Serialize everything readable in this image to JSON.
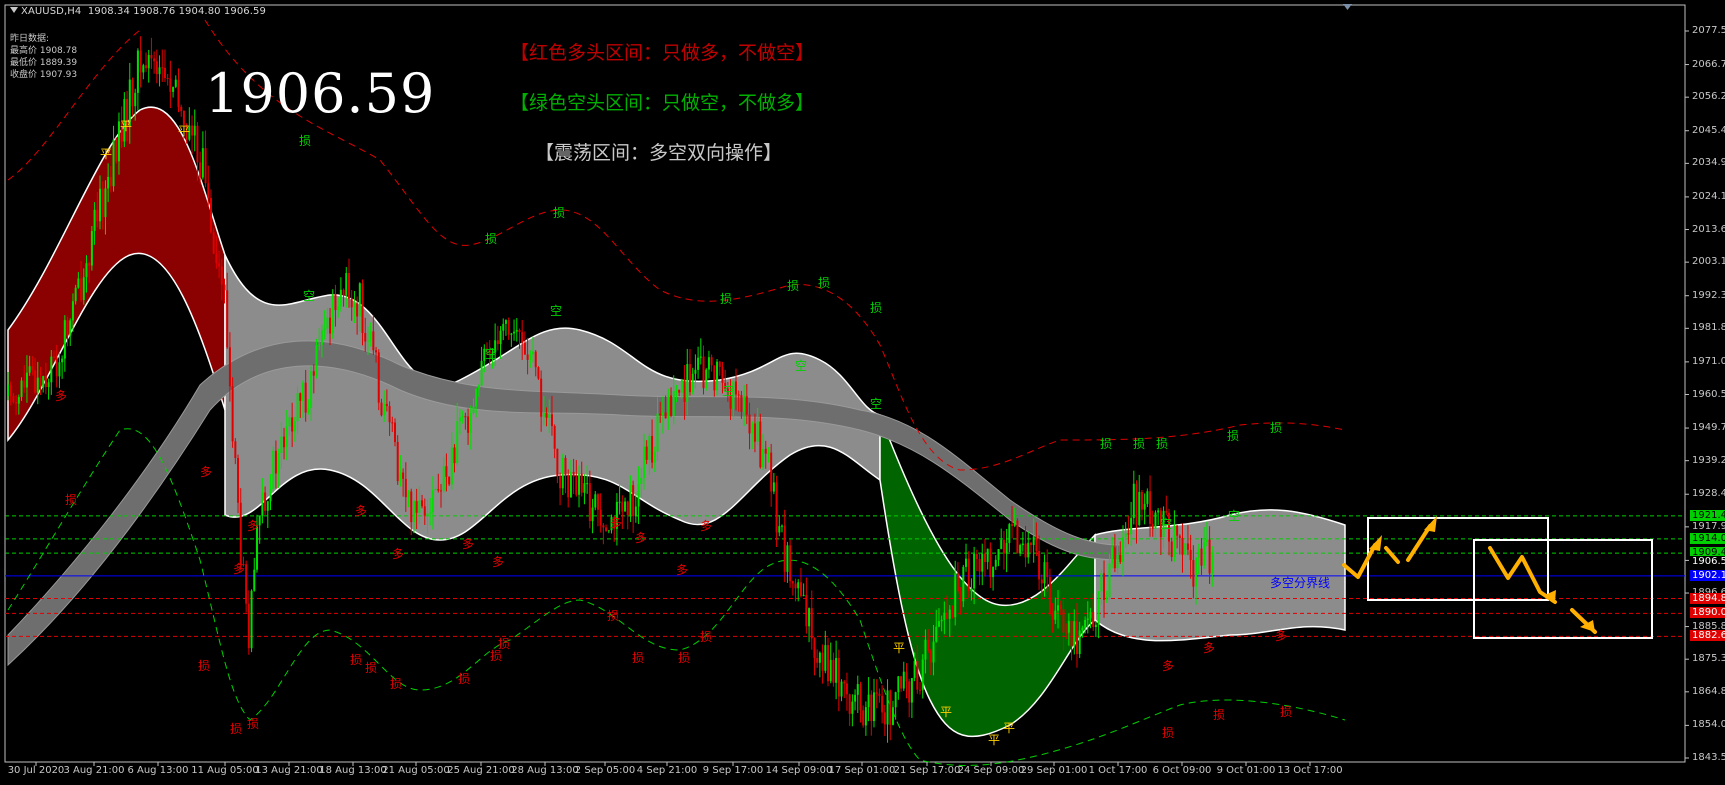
{
  "window": {
    "title": "XAUUSD,H4",
    "ohlc": "1908.34 1908.76 1904.80 1906.59"
  },
  "prev_day": {
    "heading": "昨日数据:",
    "high": "最高价 1908.78",
    "low": "最低价 1889.39",
    "close": "收盘价 1907.93"
  },
  "current_price_big": "1906.59",
  "legend": {
    "red": "【红色多头区间：只做多，不做空】",
    "green": "【绿色空头区间：只做空，不做多】",
    "range": "【震荡区间：多空双向操作】"
  },
  "colors": {
    "bull": "#e00000",
    "bear": "#00e000",
    "zone_red": "#8b0000",
    "zone_green": "#006400",
    "zone_grey": "#8c8c8c",
    "arrow": "#ffb000",
    "divider": "#0000ff"
  },
  "marker_text": {
    "ping": "平",
    "duo": "多",
    "kong": "空",
    "sun": "损"
  },
  "divider_label": "多空分界线",
  "chart_data": {
    "type": "candlestick",
    "symbol": "XAUUSD",
    "timeframe": "H4",
    "ylim": [
      1843.5,
      2082
    ],
    "price_ticks": [
      "2077.50",
      "2066.70",
      "2056.20",
      "2045.40",
      "2034.90",
      "2024.10",
      "2013.60",
      "2003.10",
      "1992.30",
      "1981.80",
      "1971.00",
      "1960.50",
      "1949.70",
      "1939.20",
      "1928.40",
      "1917.90",
      "1907.10",
      "1896.60",
      "1885.80",
      "1875.30",
      "1864.80",
      "1854.00",
      "1843.50"
    ],
    "price_tick_values": [
      2077.5,
      2066.7,
      2056.2,
      2045.4,
      2034.9,
      2024.1,
      2013.6,
      2003.1,
      1992.3,
      1981.8,
      1971.0,
      1960.5,
      1949.7,
      1939.2,
      1928.4,
      1917.9,
      1907.1,
      1896.6,
      1885.8,
      1875.3,
      1864.8,
      1854.0,
      1843.5
    ],
    "date_ticks": [
      "30 Jul 2020",
      "3 Aug 21:00",
      "6 Aug 13:00",
      "11 Aug 05:00",
      "13 Aug 21:00",
      "18 Aug 13:00",
      "21 Aug 05:00",
      "25 Aug 21:00",
      "28 Aug 13:00",
      "2 Sep 05:00",
      "4 Sep 21:00",
      "9 Sep 17:00",
      "14 Sep 09:00",
      "17 Sep 01:00",
      "21 Sep 17:00",
      "24 Sep 09:00",
      "29 Sep 01:00",
      "1 Oct 17:00",
      "6 Oct 09:00",
      "9 Oct 01:00",
      "13 Oct 17:00"
    ],
    "levels": [
      {
        "label": "1921.42",
        "value": 1921.42,
        "color": "#00d000"
      },
      {
        "label": "1914.02",
        "value": 1914.02,
        "color": "#00d000"
      },
      {
        "label": "1909.44",
        "value": 1909.44,
        "color": "#00d000"
      },
      {
        "label": "1906.59",
        "value": 1906.59,
        "color": "#c8c8c8"
      },
      {
        "label": "1902.11",
        "value": 1902.11,
        "color": "#0000ff"
      },
      {
        "label": "1894.83",
        "value": 1894.83,
        "color": "#e00000"
      },
      {
        "label": "1890.05",
        "value": 1890.05,
        "color": "#e00000"
      },
      {
        "label": "1882.64",
        "value": 1882.64,
        "color": "#e00000"
      }
    ],
    "key_closes": [
      {
        "date": "30 Jul 2020",
        "price": 1960
      },
      {
        "date": "6 Aug 13:00",
        "price": 2065
      },
      {
        "date": "11 Aug 05:00",
        "price": 1880
      },
      {
        "date": "13 Aug 21:00",
        "price": 1935
      },
      {
        "date": "18 Aug 13:00",
        "price": 1995
      },
      {
        "date": "21 Aug 05:00",
        "price": 1920
      },
      {
        "date": "28 Aug 13:00",
        "price": 1985
      },
      {
        "date": "4 Sep 21:00",
        "price": 1920
      },
      {
        "date": "14 Sep 09:00",
        "price": 1965
      },
      {
        "date": "17 Sep 01:00",
        "price": 1950
      },
      {
        "date": "24 Sep 09:00",
        "price": 1855
      },
      {
        "date": "29 Sep 01:00",
        "price": 1890
      },
      {
        "date": "1 Oct 17:00",
        "price": 1910
      },
      {
        "date": "6 Oct 09:00",
        "price": 1880
      },
      {
        "date": "9 Oct 01:00",
        "price": 1925
      },
      {
        "date": "13 Oct 17:00",
        "price": 1906.59
      }
    ]
  }
}
